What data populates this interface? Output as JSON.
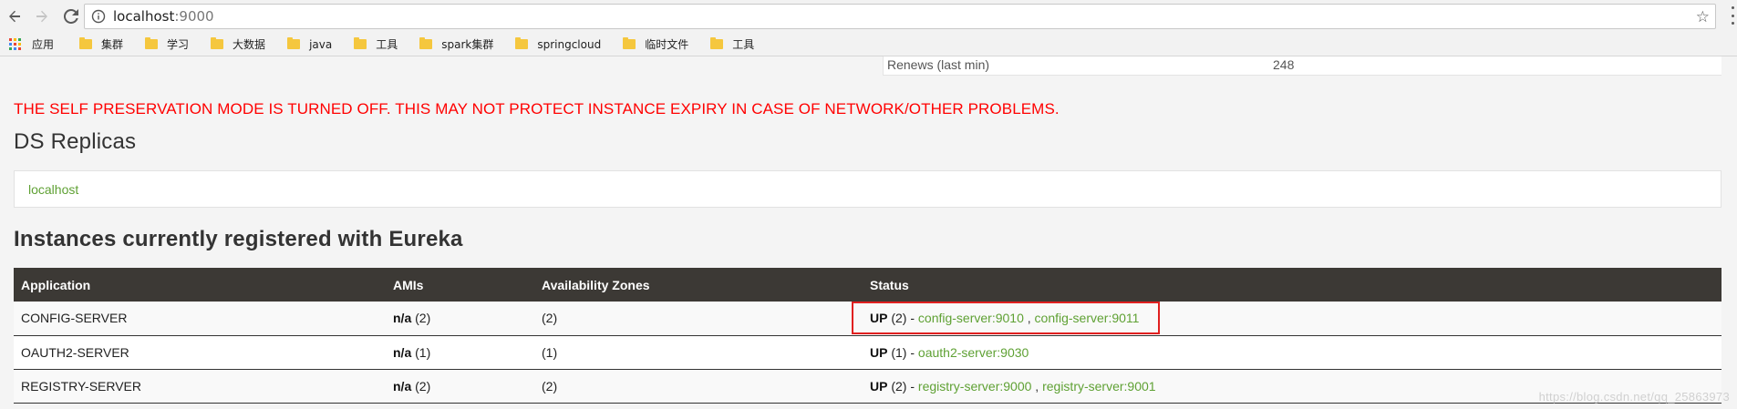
{
  "browser": {
    "url_host": "localhost",
    "url_port": ":9000",
    "bookmarks": [
      {
        "label": "应用",
        "kind": "apps"
      },
      {
        "label": "集群",
        "kind": "folder"
      },
      {
        "label": "学习",
        "kind": "folder"
      },
      {
        "label": "大数据",
        "kind": "folder"
      },
      {
        "label": "java",
        "kind": "folder"
      },
      {
        "label": "工具",
        "kind": "folder"
      },
      {
        "label": "spark集群",
        "kind": "folder"
      },
      {
        "label": "springcloud",
        "kind": "folder"
      },
      {
        "label": "临时文件",
        "kind": "folder"
      },
      {
        "label": "工具",
        "kind": "folder"
      }
    ]
  },
  "renews": {
    "label": "Renews (last min)",
    "value": "248"
  },
  "warning": "THE SELF PRESERVATION MODE IS TURNED OFF. THIS MAY NOT PROTECT INSTANCE EXPIRY IN CASE OF NETWORK/OTHER PROBLEMS.",
  "ds_replicas": {
    "title": "DS Replicas",
    "link": "localhost"
  },
  "instances": {
    "title": "Instances currently registered with Eureka",
    "headers": [
      "Application",
      "AMIs",
      "Availability Zones",
      "Status"
    ],
    "rows": [
      {
        "app": "CONFIG-SERVER",
        "ami_label": "n/a",
        "ami_count": "(2)",
        "zones": "(2)",
        "status": "UP",
        "status_count": "(2) -",
        "links": [
          "config-server:9010",
          "config-server:9011"
        ]
      },
      {
        "app": "OAUTH2-SERVER",
        "ami_label": "n/a",
        "ami_count": "(1)",
        "zones": "(1)",
        "status": "UP",
        "status_count": "(1) -",
        "links": [
          "oauth2-server:9030"
        ]
      },
      {
        "app": "REGISTRY-SERVER",
        "ami_label": "n/a",
        "ami_count": "(2)",
        "zones": "(2)",
        "status": "UP",
        "status_count": "(2) -",
        "links": [
          "registry-server:9000",
          "registry-server:9001"
        ]
      }
    ]
  },
  "watermark": "https://blog.csdn.net/qq_25863973",
  "colors": {
    "link": "#5fa134",
    "warning": "#ff0000",
    "header_bg": "#3c3935",
    "highlight": "#e02020"
  }
}
